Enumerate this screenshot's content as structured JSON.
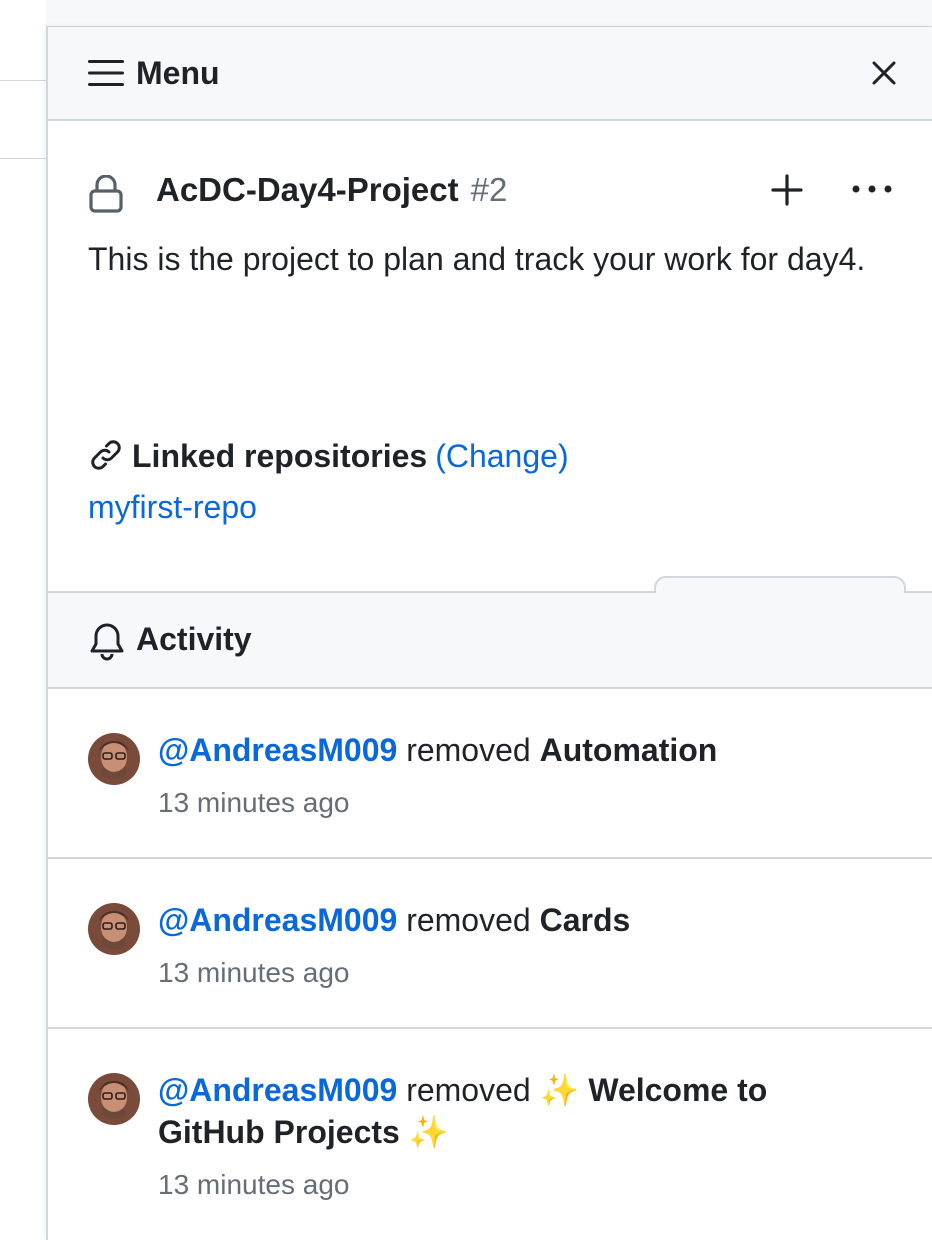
{
  "panel": {
    "title": "Menu"
  },
  "project": {
    "name": "AcDC-Day4-Project",
    "number": "#2",
    "description": "This is the project to plan and track your work for day4.",
    "linked_label": "Linked repositories",
    "change_label": "(Change)",
    "repo": "myfirst-repo",
    "close_button": "Close project"
  },
  "activity": {
    "title": "Activity",
    "items": [
      {
        "user": "@AndreasM009",
        "action": "removed",
        "target": "Automation",
        "time": "13 minutes ago"
      },
      {
        "user": "@AndreasM009",
        "action": "removed",
        "target": "Cards",
        "time": "13 minutes ago"
      },
      {
        "user": "@AndreasM009",
        "action": "removed",
        "sparkle": "✨",
        "target": "Welcome to GitHub Projects",
        "time": "13 minutes ago"
      }
    ]
  },
  "colors": {
    "link": "#0969da",
    "muted": "#656d76",
    "border": "#d0d7de",
    "header_bg": "#f6f8fa"
  },
  "icons": [
    "hamburger-icon",
    "close-icon",
    "lock-icon",
    "plus-icon",
    "kebab-icon",
    "link-icon",
    "bell-icon",
    "avatar"
  ]
}
